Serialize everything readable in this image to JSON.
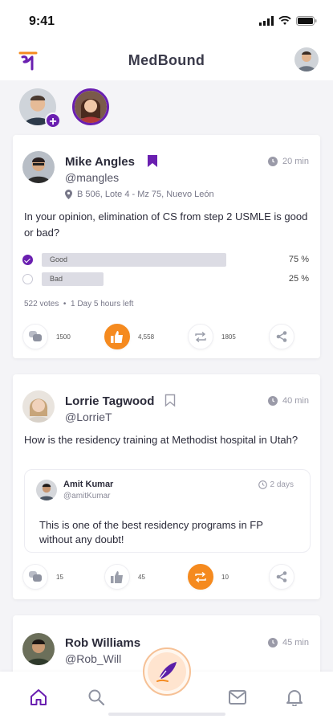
{
  "status_bar": {
    "time": "9:41"
  },
  "header": {
    "title": "MedBound",
    "logo_glyph": "म"
  },
  "stories": [
    {
      "name": "my-story",
      "has_add": true
    },
    {
      "name": "friend-story",
      "ring_color": "#6a1fb0"
    }
  ],
  "colors": {
    "accent": "#6a1fb0",
    "action_active": "#f58a1f",
    "poll_bar": "#dcdce4"
  },
  "posts": [
    {
      "author": "Mike Angles",
      "handle": "@mangles",
      "bookmarked": true,
      "time": "20 min",
      "location": "B 506, Lote 4 - Mz 75, Nuevo León",
      "question": "In your opinion, elimination of CS from step 2 USMLE is good or bad?",
      "poll": {
        "options": [
          {
            "label": "Good",
            "percent_text": "75 %",
            "percent": 75,
            "selected": true
          },
          {
            "label": "Bad",
            "percent_text": "25 %",
            "percent": 25,
            "selected": false
          }
        ],
        "votes": "522 votes",
        "remaining": "1 Day 5 hours left"
      },
      "actions": {
        "comments": "1500",
        "likes": "4,558",
        "reposts": "1805"
      }
    },
    {
      "author": "Lorrie Tagwood",
      "handle": "@LorrieT",
      "bookmarked": false,
      "time": "40 min",
      "question": "How is the residency training at Methodist hospital in Utah?",
      "reply": {
        "author": "Amit Kumar",
        "handle": "@amitKumar",
        "time": "2 days",
        "text": "This is one of the best residency programs in FP without any doubt!"
      },
      "actions": {
        "comments": "15",
        "likes": "45",
        "reposts": "10"
      }
    },
    {
      "author": "Rob Williams",
      "handle": "@Rob_Will",
      "time": "45 min"
    }
  ],
  "bottom_nav": {
    "items": [
      "home-icon",
      "search-icon",
      "compose-icon",
      "mail-icon",
      "bell-icon"
    ],
    "active": "home-icon"
  }
}
